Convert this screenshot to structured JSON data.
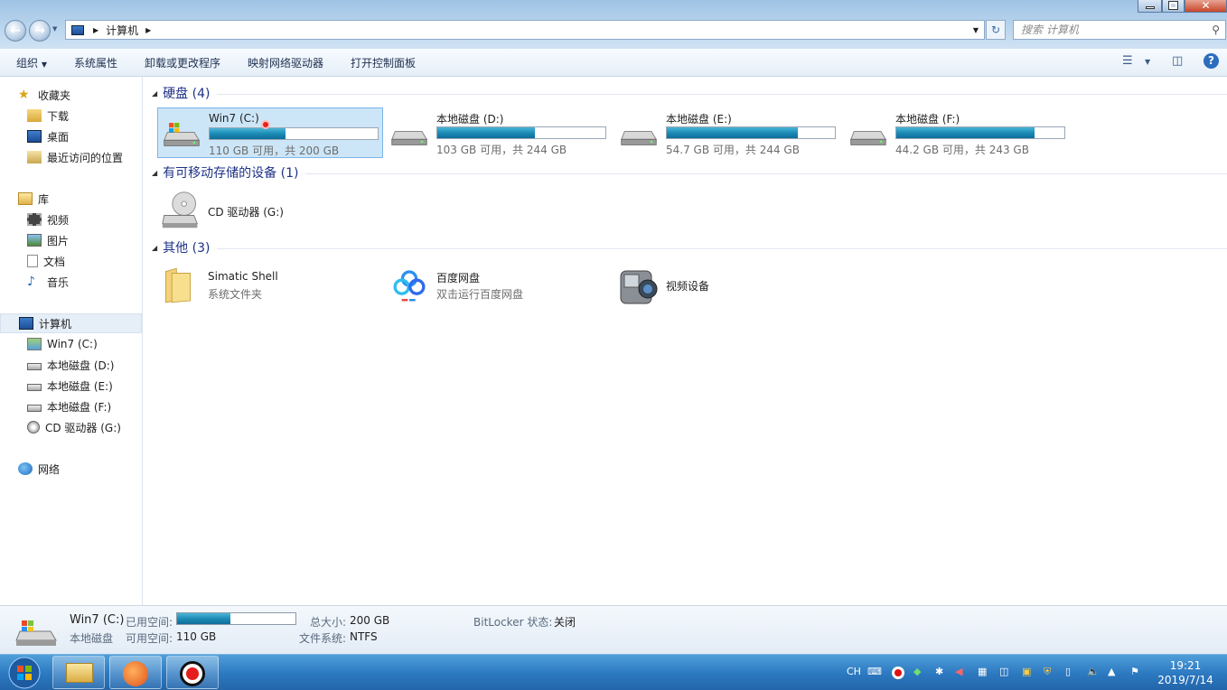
{
  "window": {
    "address_root": "计算机",
    "search_placeholder": "搜索 计算机"
  },
  "toolbar": {
    "organize": "组织",
    "system_properties": "系统属性",
    "uninstall": "卸载或更改程序",
    "map_drive": "映射网络驱动器",
    "control_panel": "打开控制面板"
  },
  "sidebar": {
    "favorites": "收藏夹",
    "downloads": "下载",
    "desktop": "桌面",
    "recent": "最近访问的位置",
    "libraries": "库",
    "videos": "视频",
    "pictures": "图片",
    "documents": "文档",
    "music": "音乐",
    "computer": "计算机",
    "drive_c": "Win7 (C:)",
    "drive_d": "本地磁盘 (D:)",
    "drive_e": "本地磁盘 (E:)",
    "drive_f": "本地磁盘 (F:)",
    "drive_g": "CD 驱动器 (G:)",
    "network": "网络"
  },
  "groups": {
    "hard_disks": "硬盘 (4)",
    "removable": "有可移动存储的设备 (1)",
    "other": "其他 (3)"
  },
  "drives": [
    {
      "name": "Win7 (C:)",
      "free_text": "110 GB 可用，共 200 GB",
      "used_fraction": 0.45
    },
    {
      "name": "本地磁盘 (D:)",
      "free_text": "103 GB 可用，共 244 GB",
      "used_fraction": 0.58
    },
    {
      "name": "本地磁盘 (E:)",
      "free_text": "54.7 GB 可用，共 244 GB",
      "used_fraction": 0.78
    },
    {
      "name": "本地磁盘 (F:)",
      "free_text": "44.2 GB 可用，共 243 GB",
      "used_fraction": 0.82
    }
  ],
  "cd_drive": {
    "name": "CD 驱动器 (G:)"
  },
  "others": [
    {
      "name": "Simatic Shell",
      "sub": "系统文件夹"
    },
    {
      "name": "百度网盘",
      "sub": "双击运行百度网盘"
    },
    {
      "name": "视频设备",
      "sub": ""
    }
  ],
  "status": {
    "drive_name": "Win7 (C:)",
    "drive_type": "本地磁盘",
    "used_label": "已用空间:",
    "free_label": "可用空间:",
    "free_value": "110 GB",
    "total_label": "总大小:",
    "total_value": "200 GB",
    "fs_label": "文件系统:",
    "fs_value": "NTFS",
    "bitlocker_label": "BitLocker 状态:",
    "bitlocker_value": "关闭",
    "used_fraction": 0.45
  },
  "taskbar": {
    "lang": "CH",
    "time": "19:21",
    "date": "2019/7/14"
  }
}
